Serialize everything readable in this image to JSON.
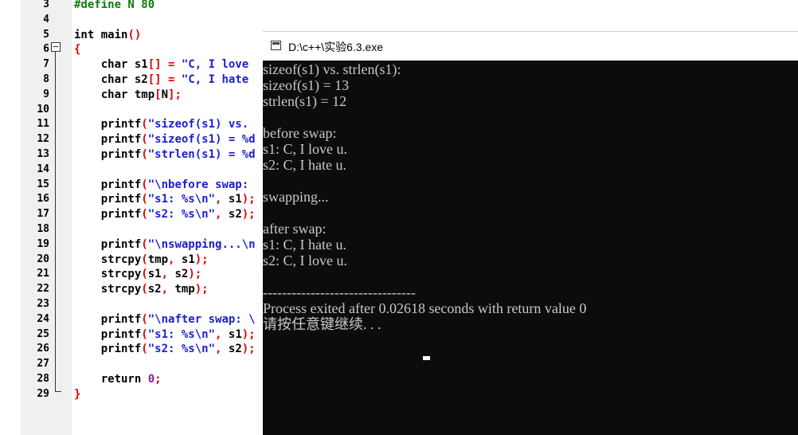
{
  "editor": {
    "line_numbers": [
      "3",
      "4",
      "5",
      "6",
      "7",
      "8",
      "9",
      "10",
      "11",
      "12",
      "13",
      "14",
      "15",
      "16",
      "17",
      "18",
      "19",
      "20",
      "21",
      "22",
      "23",
      "24",
      "25",
      "26",
      "27",
      "28",
      "29"
    ],
    "code_lines": [
      {
        "segments": [
          {
            "t": "#define N 80",
            "c": "pp"
          }
        ]
      },
      {
        "segments": []
      },
      {
        "segments": [
          {
            "t": "int main",
            "c": "kw"
          },
          {
            "t": "()",
            "c": "red"
          }
        ]
      },
      {
        "segments": [
          {
            "t": "{",
            "c": "red"
          }
        ]
      },
      {
        "segments": [
          {
            "t": "    char s1",
            "c": "kw"
          },
          {
            "t": "[]",
            "c": "red"
          },
          {
            "t": " = ",
            "c": "red"
          },
          {
            "t": "\"C, I love",
            "c": "str"
          }
        ]
      },
      {
        "segments": [
          {
            "t": "    char s2",
            "c": "kw"
          },
          {
            "t": "[]",
            "c": "red"
          },
          {
            "t": " = ",
            "c": "red"
          },
          {
            "t": "\"C, I hate",
            "c": "str"
          }
        ]
      },
      {
        "segments": [
          {
            "t": "    char tmp",
            "c": "kw"
          },
          {
            "t": "[",
            "c": "red"
          },
          {
            "t": "N",
            "c": "kw"
          },
          {
            "t": "];",
            "c": "red"
          }
        ]
      },
      {
        "segments": []
      },
      {
        "segments": [
          {
            "t": "    printf",
            "c": "kw"
          },
          {
            "t": "(",
            "c": "red"
          },
          {
            "t": "\"sizeof(s1) vs.",
            "c": "str"
          }
        ]
      },
      {
        "segments": [
          {
            "t": "    printf",
            "c": "kw"
          },
          {
            "t": "(",
            "c": "red"
          },
          {
            "t": "\"sizeof(s1) = %d",
            "c": "str"
          }
        ]
      },
      {
        "segments": [
          {
            "t": "    printf",
            "c": "kw"
          },
          {
            "t": "(",
            "c": "red"
          },
          {
            "t": "\"strlen(s1) = %d",
            "c": "str"
          }
        ]
      },
      {
        "segments": []
      },
      {
        "segments": [
          {
            "t": "    printf",
            "c": "kw"
          },
          {
            "t": "(",
            "c": "red"
          },
          {
            "t": "\"\\nbefore swap:",
            "c": "str"
          }
        ]
      },
      {
        "segments": [
          {
            "t": "    printf",
            "c": "kw"
          },
          {
            "t": "(",
            "c": "red"
          },
          {
            "t": "\"s1: %s\\n\"",
            "c": "str"
          },
          {
            "t": ", ",
            "c": "red"
          },
          {
            "t": "s1",
            "c": "kw"
          },
          {
            "t": ");",
            "c": "red"
          }
        ]
      },
      {
        "segments": [
          {
            "t": "    printf",
            "c": "kw"
          },
          {
            "t": "(",
            "c": "red"
          },
          {
            "t": "\"s2: %s\\n\"",
            "c": "str"
          },
          {
            "t": ", ",
            "c": "red"
          },
          {
            "t": "s2",
            "c": "kw"
          },
          {
            "t": ");",
            "c": "red"
          }
        ]
      },
      {
        "segments": []
      },
      {
        "segments": [
          {
            "t": "    printf",
            "c": "kw"
          },
          {
            "t": "(",
            "c": "red"
          },
          {
            "t": "\"\\nswapping...\\n",
            "c": "str"
          }
        ]
      },
      {
        "segments": [
          {
            "t": "    strcpy",
            "c": "kw"
          },
          {
            "t": "(",
            "c": "red"
          },
          {
            "t": "tmp",
            "c": "kw"
          },
          {
            "t": ", ",
            "c": "red"
          },
          {
            "t": "s1",
            "c": "kw"
          },
          {
            "t": ");",
            "c": "red"
          }
        ]
      },
      {
        "segments": [
          {
            "t": "    strcpy",
            "c": "kw"
          },
          {
            "t": "(",
            "c": "red"
          },
          {
            "t": "s1",
            "c": "kw"
          },
          {
            "t": ", ",
            "c": "red"
          },
          {
            "t": "s2",
            "c": "kw"
          },
          {
            "t": ");",
            "c": "red"
          }
        ]
      },
      {
        "segments": [
          {
            "t": "    strcpy",
            "c": "kw"
          },
          {
            "t": "(",
            "c": "red"
          },
          {
            "t": "s2",
            "c": "kw"
          },
          {
            "t": ", ",
            "c": "red"
          },
          {
            "t": "tmp",
            "c": "kw"
          },
          {
            "t": ");",
            "c": "red"
          }
        ]
      },
      {
        "segments": []
      },
      {
        "segments": [
          {
            "t": "    printf",
            "c": "kw"
          },
          {
            "t": "(",
            "c": "red"
          },
          {
            "t": "\"\\nafter swap: \\",
            "c": "str"
          }
        ]
      },
      {
        "segments": [
          {
            "t": "    printf",
            "c": "kw"
          },
          {
            "t": "(",
            "c": "red"
          },
          {
            "t": "\"s1: %s\\n\"",
            "c": "str"
          },
          {
            "t": ", ",
            "c": "red"
          },
          {
            "t": "s1",
            "c": "kw"
          },
          {
            "t": ");",
            "c": "red"
          }
        ]
      },
      {
        "segments": [
          {
            "t": "    printf",
            "c": "kw"
          },
          {
            "t": "(",
            "c": "red"
          },
          {
            "t": "\"s2: %s\\n\"",
            "c": "str"
          },
          {
            "t": ", ",
            "c": "red"
          },
          {
            "t": "s2",
            "c": "kw"
          },
          {
            "t": ");",
            "c": "red"
          }
        ]
      },
      {
        "segments": []
      },
      {
        "segments": [
          {
            "t": "    return ",
            "c": "kw"
          },
          {
            "t": "0",
            "c": "num"
          },
          {
            "t": ";",
            "c": "red"
          }
        ]
      },
      {
        "segments": [
          {
            "t": "}",
            "c": "red"
          }
        ]
      }
    ]
  },
  "console": {
    "title": "D:\\c++\\实验6.3.exe",
    "output": [
      "sizeof(s1) vs. strlen(s1):",
      "sizeof(s1) = 13",
      "strlen(s1) = 12",
      "",
      "before swap:",
      "s1: C, I love u.",
      "s2: C, I hate u.",
      "",
      "swapping...",
      "",
      "after swap:",
      "s1: C, I hate u.",
      "s2: C, I love u.",
      "",
      "--------------------------------",
      "Process exited after 0.02618 seconds with return value 0",
      "请按任意键继续. . . "
    ]
  }
}
